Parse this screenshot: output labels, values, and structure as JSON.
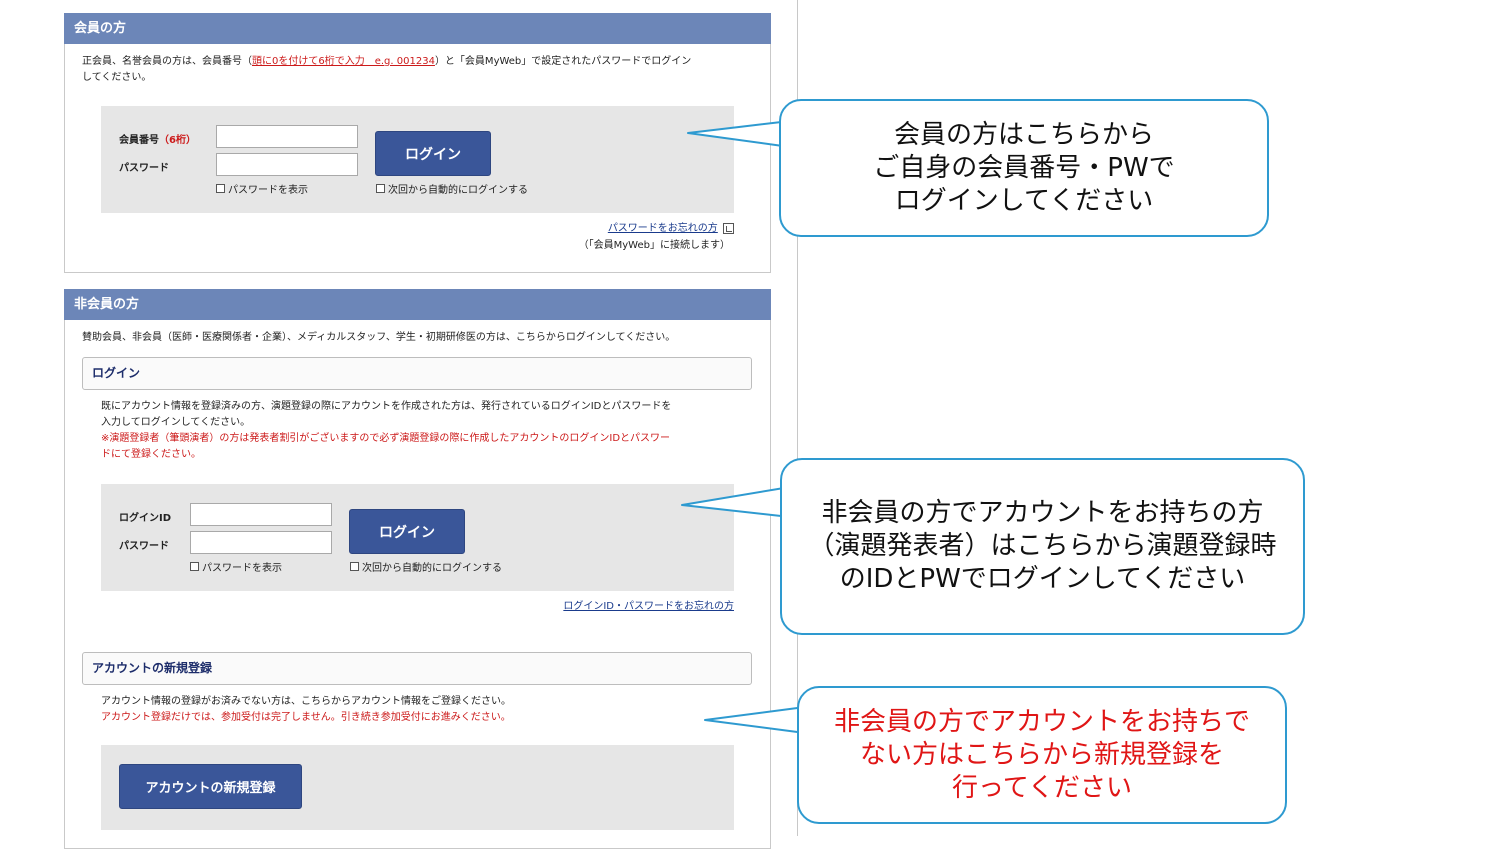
{
  "member": {
    "header": "会員の方",
    "desc_prefix": "正会員、名誉会員の方は、会員番号（",
    "desc_link": "頭に0を付けて6桁で入力　e.g. 001234",
    "desc_suffix_1": "）と「会員MyWeb」で設定されたパスワードでログイン",
    "desc_suffix_2": "してください。",
    "id_label": "会員番号",
    "id_label_note": "（6桁）",
    "password_label": "パスワード",
    "show_password": "パスワードを表示",
    "auto_login": "次回から自動的にログインする",
    "login_button": "ログイン",
    "forgot_link": "パスワードをお忘れの方",
    "myweb_note": "（「会員MyWeb」に接続します）"
  },
  "nonmember": {
    "header": "非会員の方",
    "desc": "賛助会員、非会員（医師・医療関係者・企業）、メディカルスタッフ、学生・初期研修医の方は、こちらからログインしてください。",
    "login_section_title": "ログイン",
    "login_desc_1": "既にアカウント情報を登録済みの方、演題登録の際にアカウントを作成された方は、発行されているログインIDとパスワードを",
    "login_desc_2": "入力してログインしてください。",
    "login_warn_1": "※演題登録者（筆頭演者）の方は発表者割引がございますので必ず演題登録の際に作成したアカウントのログインIDとパスワー",
    "login_warn_2": "ドにて登録ください。",
    "id_label": "ログインID",
    "password_label": "パスワード",
    "show_password": "パスワードを表示",
    "auto_login": "次回から自動的にログインする",
    "login_button": "ログイン",
    "forgot_link": "ログインID・パスワードをお忘れの方",
    "register_section_title": "アカウントの新規登録",
    "register_desc": "アカウント情報の登録がお済みでない方は、こちらからアカウント情報をご登録ください。",
    "register_warn": "アカウント登録だけでは、参加受付は完了しません。引き続き参加受付にお進みください。",
    "register_button": "アカウントの新規登録"
  },
  "callouts": {
    "member": [
      "会員の方はこちらから",
      "ご自身の会員番号・PWで",
      "ログインしてください"
    ],
    "nonmember_login": [
      "非会員の方でアカウントをお持ちの方",
      "（演題発表者）はこちらから演題登録時",
      "のIDとPWでログインしてください"
    ],
    "nonmember_register": [
      "非会員の方でアカウントをお持ちで",
      "ない方はこちらから新規登録を",
      "行ってください"
    ]
  },
  "colors": {
    "header_bg": "#6c86b8",
    "button_bg": "#3a5699",
    "callout_border": "#2e9ad0",
    "warning_red": "#cc1a1a",
    "callout_red": "#e01616"
  }
}
